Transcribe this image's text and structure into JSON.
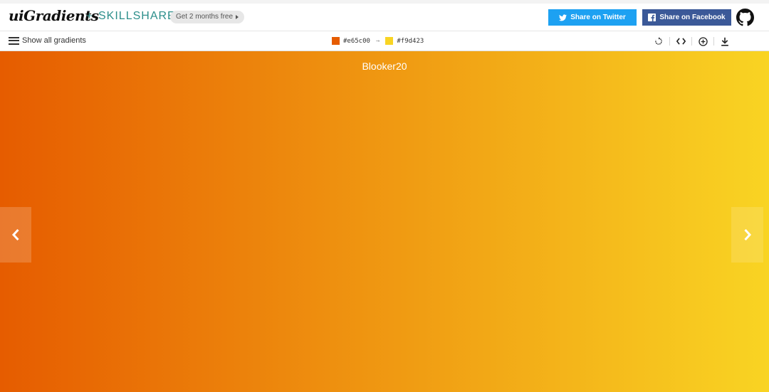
{
  "header": {
    "logo_text": "uiGradients",
    "plus": "+",
    "partner": "SKILLSHARE",
    "promo_label": "Get 2 months free",
    "twitter_label": "Share on Twitter",
    "facebook_label": "Share on Facebook"
  },
  "toolbar": {
    "menu_label": "Show all gradients",
    "color_from": "#e65c00",
    "color_arrow": "→",
    "color_to": "#f9d423",
    "tools": [
      "rotate-icon",
      "code-icon",
      "add-icon",
      "download-icon"
    ]
  },
  "gradient": {
    "name": "Blooker20",
    "direction": "to right",
    "colors": [
      "#e65c00",
      "#f9d423"
    ]
  },
  "colors": {
    "twitter": "#1da1f2",
    "facebook": "#3b5998",
    "skillshare": "#2d8f8b"
  }
}
